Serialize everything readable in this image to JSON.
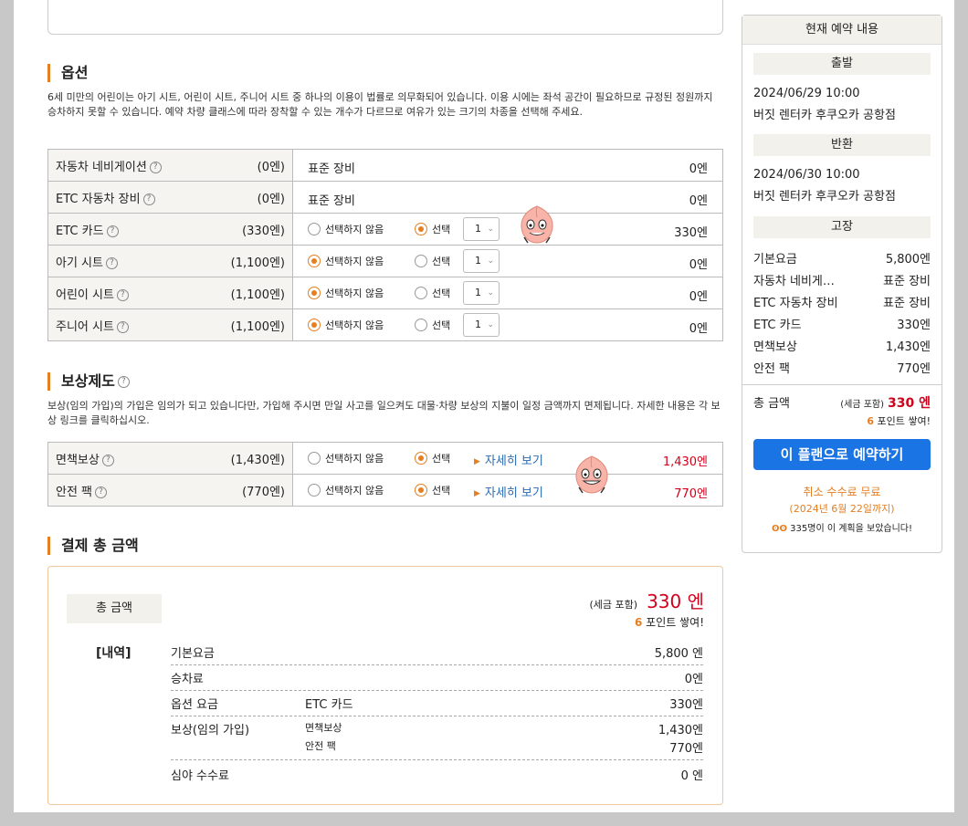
{
  "options": {
    "title": "옵션",
    "description": "6세 미만의 어린이는 아기 시트, 어린이 시트, 주니어 시트 중 하나의 이용이 법률로 의무화되어 있습니다. 이용 시에는 좌석 공간이 필요하므로 규정된 정원까지 승차하지 못할 수 있습니다. 예약 차량 클래스에 따라 장착할 수 있는 개수가 다르므로 여유가 있는 크기의 차종을 선택해 주세요.",
    "help_icon": "?",
    "radio_none": "선택하지 않음",
    "radio_select": "선택",
    "rows": [
      {
        "label": "자동차 네비게이션",
        "price": "(0엔)",
        "value": "표준 장비",
        "amount": "0엔"
      },
      {
        "label": "ETC 자동차 장비",
        "price": "(0엔)",
        "value": "표준 장비",
        "amount": "0엔"
      },
      {
        "label": "ETC 카드",
        "price": "(330엔)",
        "qty": "1",
        "amount": "330엔"
      },
      {
        "label": "아기 시트",
        "price": "(1,100엔)",
        "qty": "1",
        "amount": "0엔"
      },
      {
        "label": "어린이 시트",
        "price": "(1,100엔)",
        "qty": "1",
        "amount": "0엔"
      },
      {
        "label": "주니어 시트",
        "price": "(1,100엔)",
        "qty": "1",
        "amount": "0엔"
      }
    ]
  },
  "insurance": {
    "title": "보상제도",
    "description": "보상(임의 가입)의 가입은 임의가 되고 있습니다만, 가입해 주시면 만일 사고를 일으켜도 대물·차량 보상의 지불이 일정 금액까지 면제됩니다. 자세한 내용은 각 보상 링크를 클릭하십시오.",
    "detail_link": "자세히 보기",
    "rows": [
      {
        "label": "면책보상",
        "price": "(1,430엔)",
        "amount": "1,430엔"
      },
      {
        "label": "안전 팩",
        "price": "(770엔)",
        "amount": "770엔"
      }
    ]
  },
  "payment": {
    "title": "결제 총 금액",
    "total_label": "총 금액",
    "tax_note": "(세금 포함)",
    "total": "330 엔",
    "points_num": "6",
    "points_text": " 포인트 쌓여!",
    "breakdown_label": "[내역]",
    "rows": [
      {
        "name": "기본요금",
        "item": "",
        "amount": "5,800 엔"
      },
      {
        "name": "승차료",
        "item": "",
        "amount": "0엔"
      },
      {
        "name": "옵션 요금",
        "item": "ETC 카드",
        "amount": "330엔"
      },
      {
        "name": "보상(임의 가입)",
        "item": "면책보상",
        "amount": "1,430엔",
        "item2": "안전 팩",
        "amount2": "770엔"
      },
      {
        "name": "심야 수수료",
        "item": "",
        "amount": "0 엔"
      }
    ]
  },
  "sidebar": {
    "title": "현재 예약 내용",
    "departure_label": "출발",
    "departure_time": "2024/06/29 10:00",
    "departure_place": "버짓 렌터카 후쿠오카 공항점",
    "return_label": "반환",
    "return_time": "2024/06/30 10:00",
    "return_place": "버짓 렌터카 후쿠오카 공항점",
    "fixed_label": "고장",
    "fees": [
      {
        "name": "기본요금",
        "value": "5,800엔"
      },
      {
        "name": "자동차 네비게…",
        "value": "표준 장비"
      },
      {
        "name": "ETC 자동차 장비",
        "value": "표준 장비"
      },
      {
        "name": "ETC 카드",
        "value": "330엔"
      },
      {
        "name": "면책보상",
        "value": "1,430엔"
      },
      {
        "name": "안전 팩",
        "value": "770엔"
      }
    ],
    "total_label": "총 금액",
    "tax_note": "(세금 포함)",
    "total": "330 엔",
    "points_num": "6",
    "points_text": " 포인트 쌓여!",
    "book_button": "이 플랜으로 예약하기",
    "cancel_free": "취소 수수료 무료",
    "cancel_until": "(2024년 6월 22일까지)",
    "viewers_icon": "ʘʘ",
    "viewers_text": "335명이 이 계획을 보았습니다!"
  },
  "colors": {
    "accent": "#e67e22",
    "price_red": "#d0021b",
    "button_blue": "#1b74e4"
  }
}
